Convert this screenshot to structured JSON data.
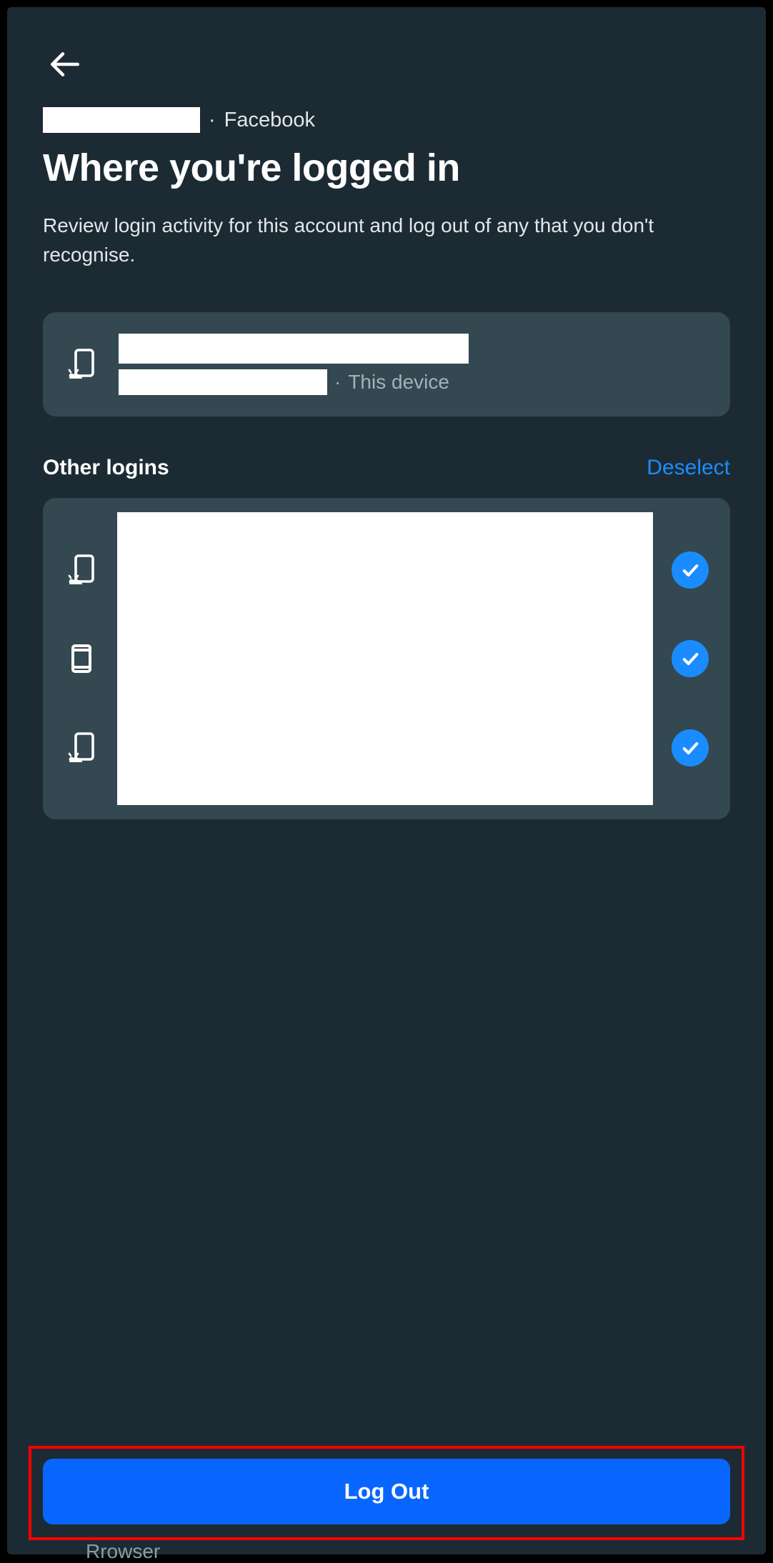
{
  "breadcrumb": {
    "separator": "·",
    "app": "Facebook"
  },
  "page": {
    "title": "Where you're logged in",
    "subtitle": "Review login activity for this account and log out of any that you don't recognise."
  },
  "current_device": {
    "meta_separator": "·",
    "meta_label": "This device",
    "icon": "android-device-icon"
  },
  "section": {
    "title": "Other logins",
    "action": "Deselect"
  },
  "other_logins": [
    {
      "icon": "android-device-icon",
      "selected": true
    },
    {
      "icon": "tablet-device-icon",
      "selected": true
    },
    {
      "icon": "android-device-icon",
      "selected": true
    }
  ],
  "footer": {
    "logout_label": "Log Out"
  },
  "underlay": {
    "partial_text": "Rrowser"
  },
  "colors": {
    "bg": "#1c2b33",
    "card": "#334850",
    "accent": "#1a8cff",
    "primary_btn": "#0866ff",
    "highlight": "#ff0000"
  }
}
